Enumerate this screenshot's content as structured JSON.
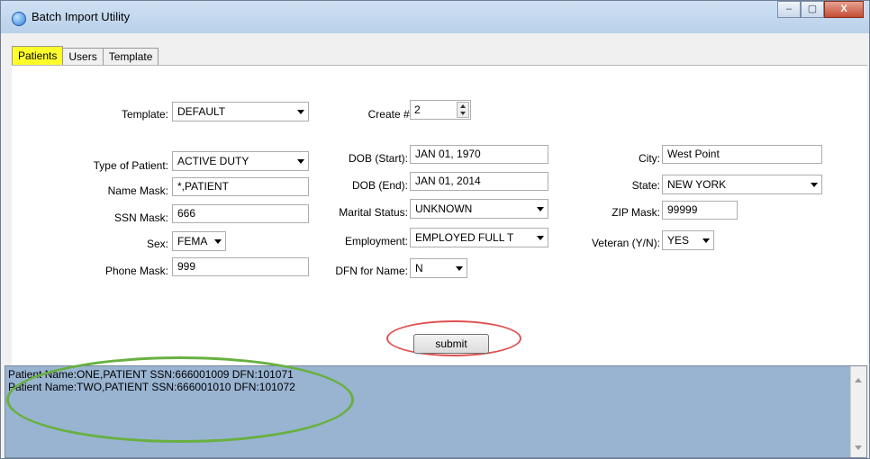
{
  "window": {
    "title": "Batch Import Utility",
    "minimize_glyph": "–",
    "maximize_glyph": "▢",
    "close_glyph": "X"
  },
  "tabs": [
    {
      "label": "Patients",
      "active": true
    },
    {
      "label": "Users",
      "active": false
    },
    {
      "label": "Template",
      "active": false
    }
  ],
  "form": {
    "template": {
      "label": "Template:",
      "value": "DEFAULT"
    },
    "create": {
      "label": "Create #:",
      "value": "2"
    },
    "type_of_patient": {
      "label": "Type of Patient:",
      "value": "ACTIVE DUTY"
    },
    "name_mask": {
      "label": "Name Mask:",
      "value": "*,PATIENT"
    },
    "ssn_mask": {
      "label": "SSN Mask:",
      "value": "666"
    },
    "sex": {
      "label": "Sex:",
      "value": "FEMA"
    },
    "phone_mask": {
      "label": "Phone Mask:",
      "value": "999"
    },
    "dob_start": {
      "label": "DOB (Start):",
      "value": "JAN 01, 1970"
    },
    "dob_end": {
      "label": "DOB (End):",
      "value": "JAN 01, 2014"
    },
    "marital_status": {
      "label": "Marital Status:",
      "value": "UNKNOWN"
    },
    "employment": {
      "label": "Employment:",
      "value": "EMPLOYED FULL T"
    },
    "dfn_for_name": {
      "label": "DFN for Name:",
      "value": "N"
    },
    "city": {
      "label": "City:",
      "value": "West Point"
    },
    "state": {
      "label": "State:",
      "value": "NEW YORK"
    },
    "zip_mask": {
      "label": "ZIP Mask:",
      "value": "99999"
    },
    "veteran": {
      "label": "Veteran (Y/N):",
      "value": "YES"
    }
  },
  "submit_label": "submit",
  "output_lines": [
    "Patient Name:ONE,PATIENT SSN:666001009 DFN:101071",
    "Patient Name:TWO,PATIENT SSN:666001010 DFN:101072"
  ],
  "annotation_colors": {
    "submit_ring": "#e05050",
    "output_ring": "#68b040"
  }
}
